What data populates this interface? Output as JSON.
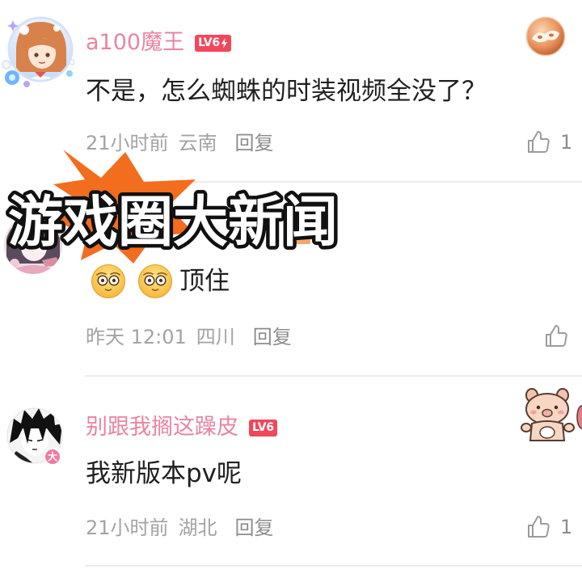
{
  "overlay": {
    "headline": "游戏圈大新闻"
  },
  "comments": [
    {
      "username": "a100魔王",
      "level": "LV6",
      "text": "不是，怎么蜘蛛的时装视频全没了？",
      "time": "21小时前",
      "location": "云南",
      "reply_label": "回复",
      "like_count": "1"
    },
    {
      "emoji": [
        "smiling-face-icon",
        "smiling-face-icon"
      ],
      "text": "顶住",
      "time": "昨天 12:01",
      "location": "四川",
      "reply_label": "回复"
    },
    {
      "username": "别跟我搁这躁皮",
      "level": "LV6",
      "avatar_badge": "大",
      "text": "我新版本pv呢",
      "time": "21小时前",
      "location": "湖北",
      "reply_label": "回复",
      "like_count": "1"
    }
  ],
  "icons": {
    "like": "thumbs-up-icon",
    "level_bolt": "lightning-icon",
    "decoration_1": "decoration-badge-icon",
    "decoration_3": "pig-sticker-icon",
    "overlay_burst": "starburst-icon"
  },
  "colors": {
    "username": "#e9849f",
    "level_badge": "#f2475b",
    "text": "#1f1f1f",
    "meta": "#a3a3a3",
    "reply": "#8c8c8c",
    "divider": "#ececec",
    "starburst": "#f36d1f",
    "avatar_badge": "#f07aa0"
  }
}
